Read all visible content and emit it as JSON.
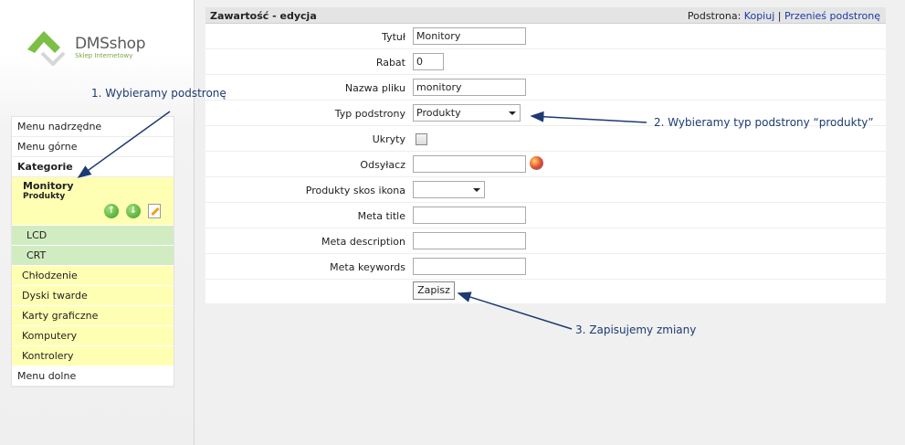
{
  "logo": {
    "name": "DMSshop",
    "tagline": "Sklep Internetowy"
  },
  "sidebar": {
    "items": [
      {
        "label": "Menu nadrzędne"
      },
      {
        "label": "Menu górne"
      },
      {
        "label": "Kategorie"
      }
    ],
    "active": {
      "title": "Monitory",
      "subtitle": "Produkty"
    },
    "children": [
      {
        "label": "LCD"
      },
      {
        "label": "CRT"
      }
    ],
    "categories": [
      {
        "label": "Chłodzenie"
      },
      {
        "label": "Dyski twarde"
      },
      {
        "label": "Karty graficzne"
      },
      {
        "label": "Komputery"
      },
      {
        "label": "Kontrolery"
      }
    ],
    "bottom": {
      "label": "Menu dolne"
    }
  },
  "header": {
    "title": "Zawartość - edycja",
    "prefix": "Podstrona:",
    "copy_link": "Kopiuj",
    "separator": "|",
    "move_link": "Przenieś podstronę"
  },
  "form": {
    "tytul": {
      "label": "Tytuł",
      "value": "Monitory"
    },
    "rabat": {
      "label": "Rabat",
      "value": "0"
    },
    "nazwa": {
      "label": "Nazwa pliku",
      "value": "monitory"
    },
    "typ": {
      "label": "Typ podstrony",
      "value": "Produkty"
    },
    "ukryty": {
      "label": "Ukryty",
      "checked": false
    },
    "odsylacz": {
      "label": "Odsyłacz",
      "value": ""
    },
    "skos": {
      "label": "Produkty skos ikona",
      "value": ""
    },
    "meta_title": {
      "label": "Meta title",
      "value": ""
    },
    "meta_desc": {
      "label": "Meta description",
      "value": ""
    },
    "meta_keys": {
      "label": "Meta keywords",
      "value": ""
    },
    "save_label": "Zapisz"
  },
  "annotations": {
    "a1": "1. Wybieramy podstronę",
    "a2": "2. Wybieramy typ podstrony “produkty”",
    "a3": "3. Zapisujemy zmiany"
  },
  "colors": {
    "annotation": "#1d3a72",
    "highlight": "#ffffb4",
    "child": "#d2ecc2",
    "link": "#1a38a8"
  }
}
